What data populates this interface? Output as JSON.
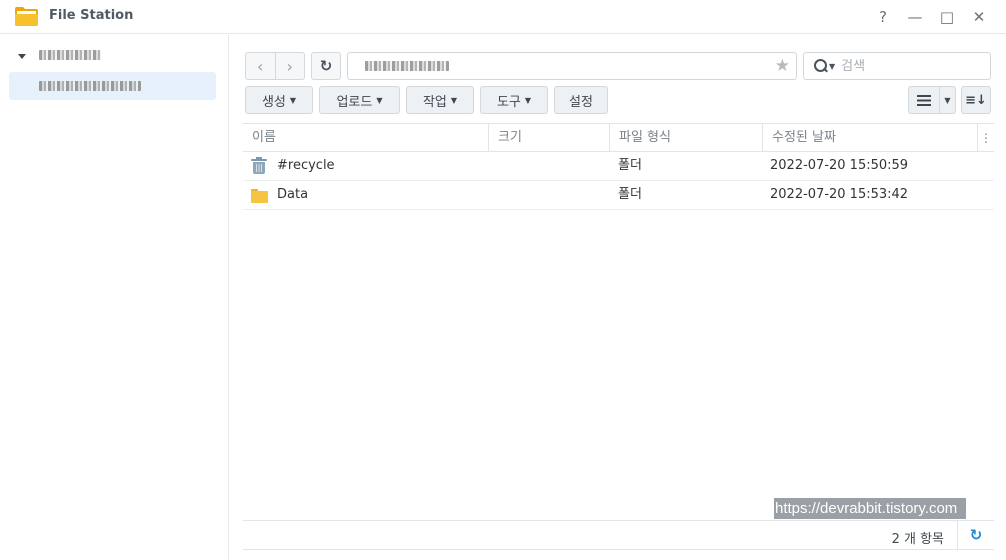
{
  "window": {
    "title": "File Station",
    "controls": {
      "help": "?",
      "minimize": "—",
      "maximize": "□",
      "close": "✕"
    }
  },
  "sidebar": {
    "root_label": "(blurred)",
    "child_label": "(blurred)"
  },
  "toolbar": {
    "back": "‹",
    "forward": "›",
    "refresh": "↻",
    "path": "(blurred)",
    "star": "★",
    "search_placeholder": "검색",
    "actions": [
      {
        "label": "생성",
        "has_dropdown": true
      },
      {
        "label": "업로드",
        "has_dropdown": true
      },
      {
        "label": "작업",
        "has_dropdown": true
      },
      {
        "label": "도구",
        "has_dropdown": true
      },
      {
        "label": "설정",
        "has_dropdown": false
      }
    ],
    "sort_icon": "≡↓"
  },
  "table": {
    "columns": [
      "이름",
      "크기",
      "파일 형식",
      "수정된 날짜"
    ],
    "rows": [
      {
        "icon": "recycle-bin-icon",
        "name": "#recycle",
        "size": "",
        "type": "폴더",
        "modified": "2022-07-20 15:50:59"
      },
      {
        "icon": "folder-icon",
        "name": "Data",
        "size": "",
        "type": "폴더",
        "modified": "2022-07-20 15:53:42"
      }
    ]
  },
  "status": {
    "count": "2 개 항목",
    "refresh": "↻"
  },
  "watermark": "https://devrabbit.tistory.com",
  "colors": {
    "selected_bg": "#e7f1fc",
    "folder": "#f6c343",
    "recycle": "#8ea7bb",
    "accent": "#1f8ad6"
  }
}
